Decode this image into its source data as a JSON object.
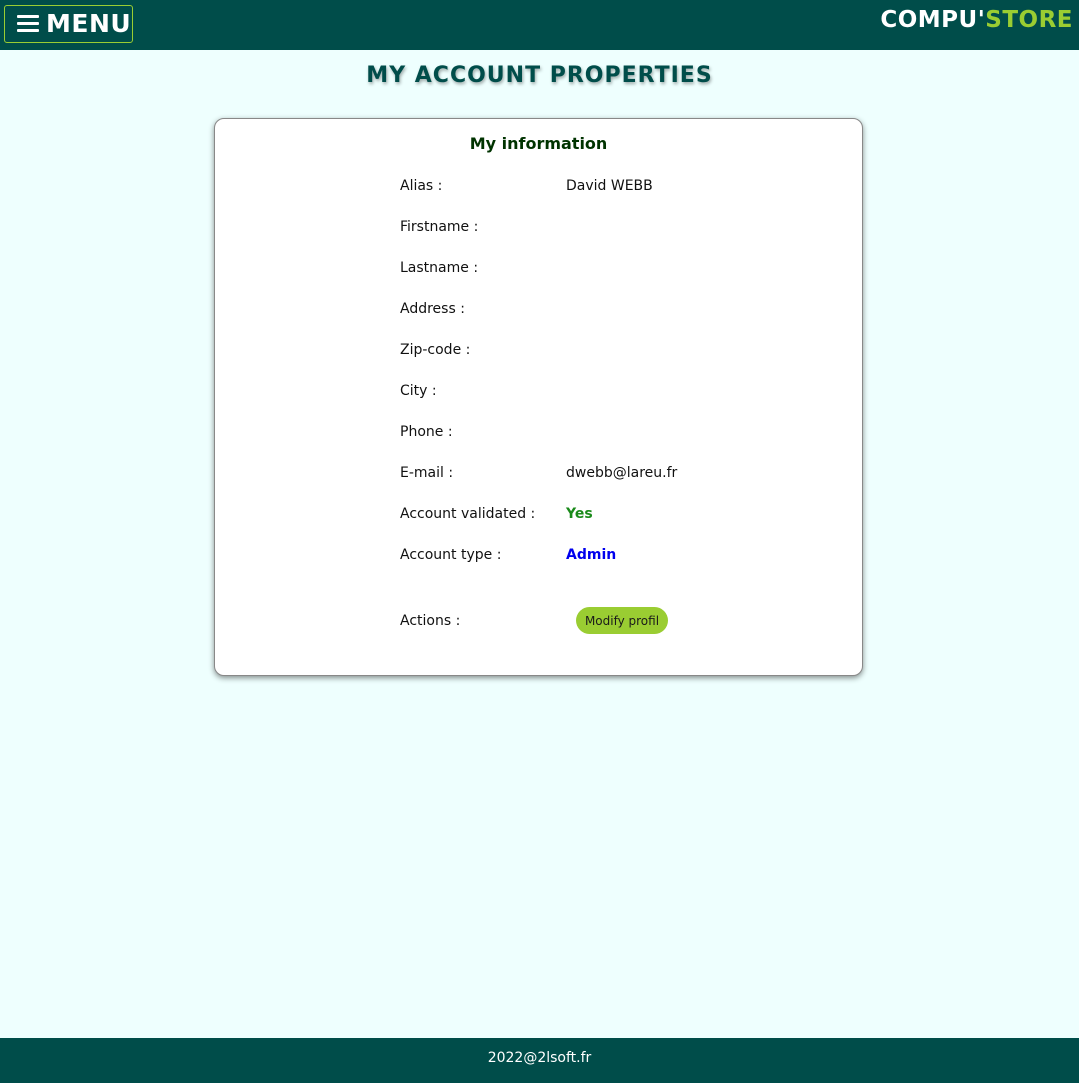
{
  "header": {
    "menu_icon": "hamburger-icon",
    "menu_label": "MENU",
    "brand_part1": "COMPU'",
    "brand_part2": "STORE",
    "colors": {
      "bar": "#004d4a",
      "accent": "#9acd32"
    }
  },
  "page": {
    "title": "MY ACCOUNT PROPERTIES"
  },
  "card": {
    "title": "My information",
    "fields": [
      {
        "label": "Alias :",
        "value": "David WEBB"
      },
      {
        "label": "Firstname :",
        "value": ""
      },
      {
        "label": "Lastname :",
        "value": ""
      },
      {
        "label": "Address :",
        "value": ""
      },
      {
        "label": "Zip-code :",
        "value": ""
      },
      {
        "label": "City :",
        "value": ""
      },
      {
        "label": "Phone :",
        "value": ""
      },
      {
        "label": "E-mail :",
        "value": "dwebb@lareu.fr"
      },
      {
        "label": "Account validated :",
        "value": "Yes",
        "color": "#1a8a1a"
      },
      {
        "label": "Account type :",
        "value": "Admin",
        "color": "#0000ee"
      }
    ],
    "actions_label": "Actions :",
    "modify_button": "Modify profil"
  },
  "footer": {
    "text": "2022@2lsoft.fr"
  }
}
